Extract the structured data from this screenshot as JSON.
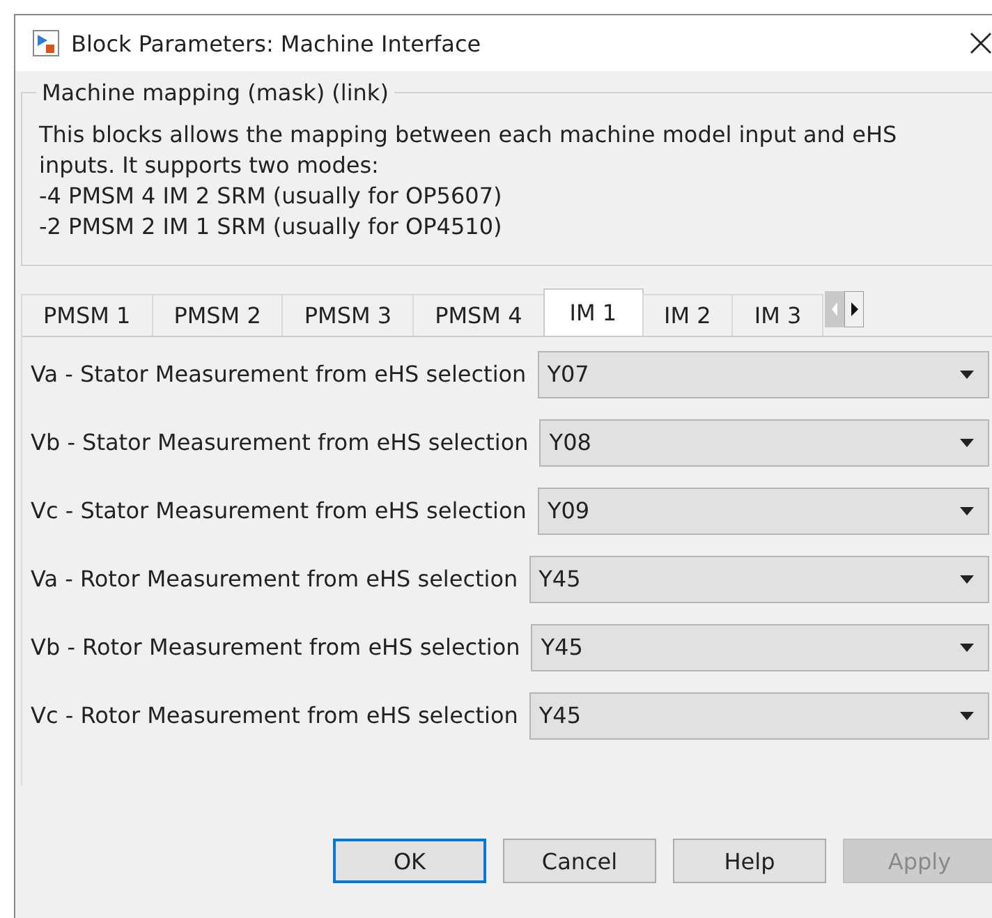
{
  "window": {
    "title": "Block Parameters: Machine Interface"
  },
  "group": {
    "title": "Machine mapping (mask) (link)",
    "description": [
      "This blocks allows the mapping between each machine model input and eHS inputs. It supports two modes:",
      "-4 PMSM 4 IM 2 SRM (usually for OP5607)",
      "-2 PMSM 2 IM 1 SRM (usually for OP4510)"
    ]
  },
  "tabs": [
    {
      "label": "PMSM 1",
      "selected": false
    },
    {
      "label": "PMSM 2",
      "selected": false
    },
    {
      "label": "PMSM 3",
      "selected": false
    },
    {
      "label": "PMSM 4",
      "selected": false
    },
    {
      "label": "IM 1",
      "selected": true
    },
    {
      "label": "IM 2",
      "selected": false
    },
    {
      "label": "IM 3",
      "selected": false
    }
  ],
  "parameters": [
    {
      "label": "Va - Stator Measurement from eHS selection",
      "value": "Y07"
    },
    {
      "label": "Vb - Stator Measurement from eHS selection",
      "value": "Y08"
    },
    {
      "label": "Vc - Stator Measurement from eHS selection",
      "value": "Y09"
    },
    {
      "label": "Va - Rotor Measurement from eHS selection",
      "value": "Y45"
    },
    {
      "label": "Vb - Rotor Measurement from eHS selection",
      "value": "Y45"
    },
    {
      "label": "Vc - Rotor Measurement from eHS selection",
      "value": "Y45"
    }
  ],
  "buttons": [
    {
      "label": "OK",
      "disabled": false,
      "default": true
    },
    {
      "label": "Cancel",
      "disabled": false,
      "default": false
    },
    {
      "label": "Help",
      "disabled": false,
      "default": false
    },
    {
      "label": "Apply",
      "disabled": true,
      "default": false
    }
  ]
}
